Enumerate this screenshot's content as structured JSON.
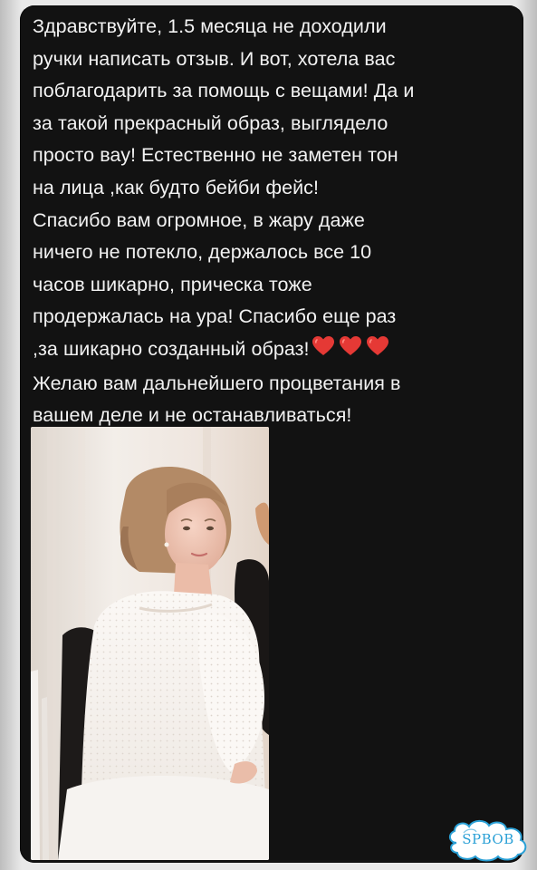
{
  "message": {
    "lines": [
      "Здравствуйте, 1.5 месяца не доходили",
      "ручки написать отзыв. И вот, хотела вас",
      "поблагодарить за помощь с вещами! Да и",
      "за такой прекрасный образ, выглядело",
      "просто вау! Естественно не заметен тон",
      "на лица ,как будто бейби фейс!",
      "Спасибо вам огромное, в жару даже",
      "ничего не потекло, держалось все 10",
      "часов шикарно, прическа тоже",
      "продержалась на ура! Спасибо еще раз",
      ",за шикарно созданный образ!",
      "Желаю вам дальнейшего процветания в",
      "вашем деле и не останавливаться!"
    ],
    "emoji": [
      "heart-emoji",
      "heart-emoji",
      "heart-emoji"
    ],
    "heart_color": "#e53935"
  },
  "photo": {
    "subject": "bride-portrait-photo"
  },
  "watermark": {
    "text": "SPBOB",
    "color": "#2aa0d6"
  },
  "colors": {
    "bubble_bg": "#121212",
    "text": "#f2f2f2"
  }
}
